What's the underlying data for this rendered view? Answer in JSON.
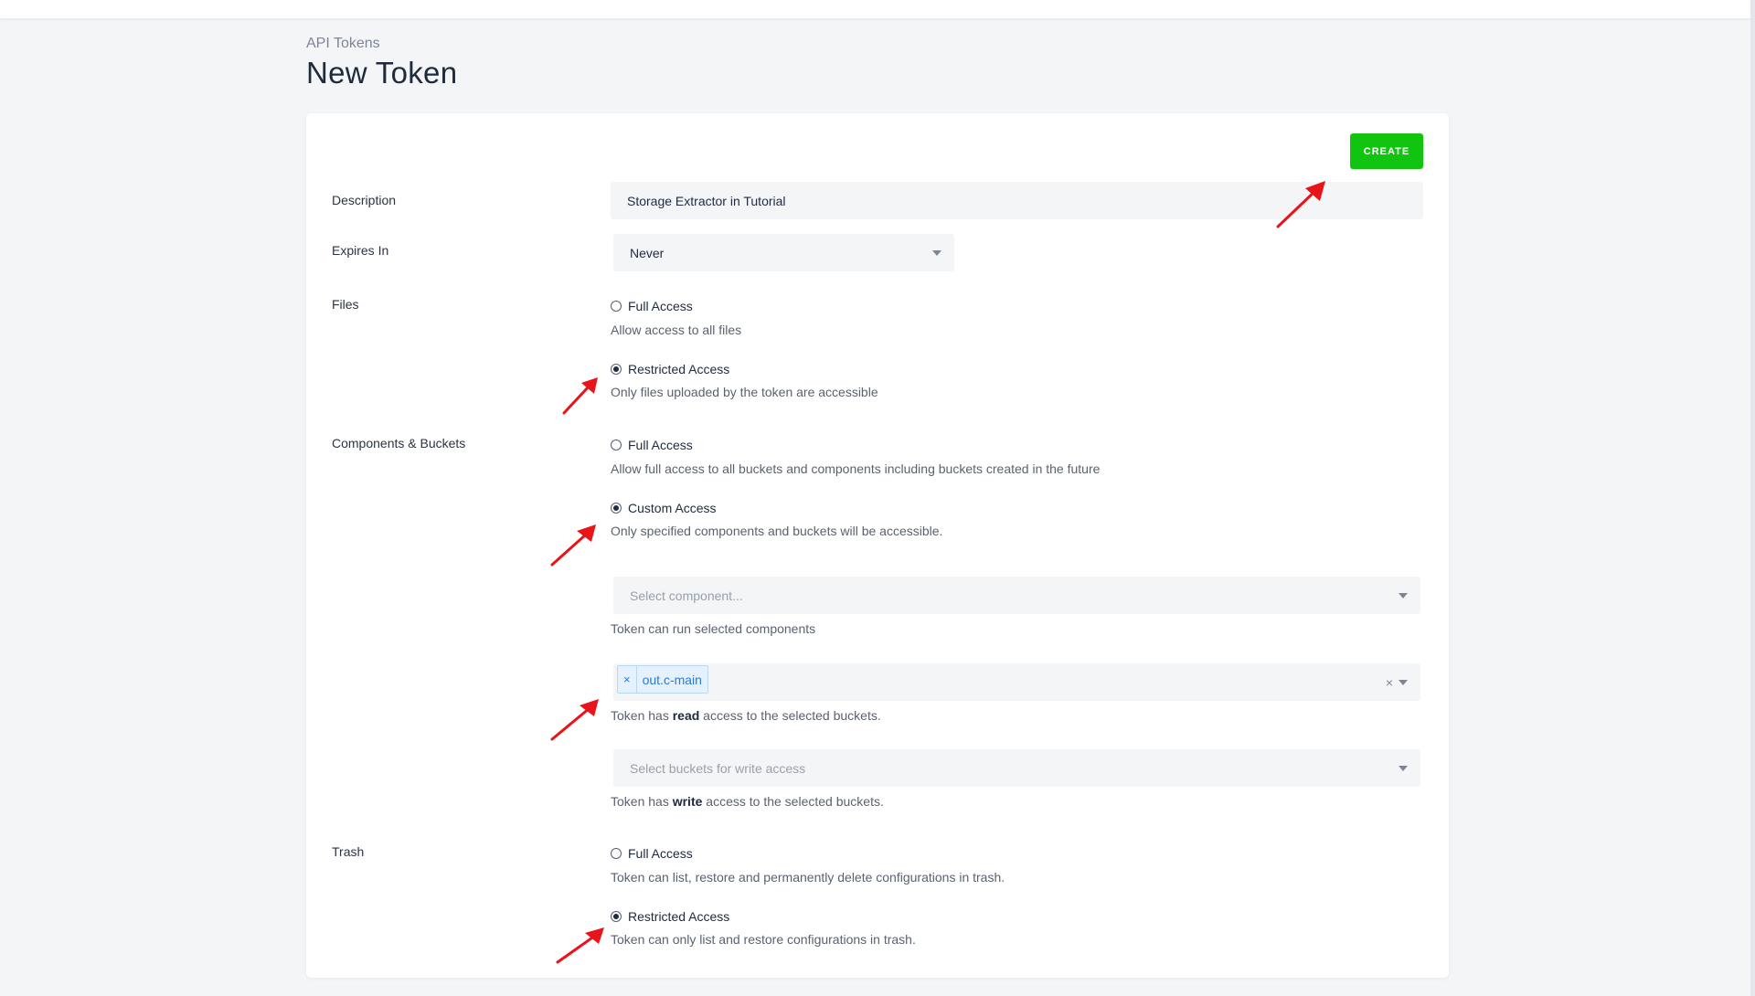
{
  "header": {
    "breadcrumb": "API Tokens",
    "title": "New Token"
  },
  "actions": {
    "create_label": "CREATE"
  },
  "form": {
    "description": {
      "label": "Description",
      "value": "Storage Extractor in Tutorial"
    },
    "expires": {
      "label": "Expires In",
      "value": "Never"
    },
    "files": {
      "label": "Files",
      "options": [
        {
          "label": "Full Access",
          "help": "Allow access to all files",
          "checked": false
        },
        {
          "label": "Restricted Access",
          "help": "Only files uploaded by the token are accessible",
          "checked": true
        }
      ]
    },
    "components": {
      "label": "Components & Buckets",
      "options": [
        {
          "label": "Full Access",
          "help": "Allow full access to all buckets and components including buckets created in the future",
          "checked": false
        },
        {
          "label": "Custom Access",
          "help": "Only specified components and buckets will be accessible.",
          "checked": true
        }
      ],
      "component_select": {
        "placeholder": "Select component...",
        "help": "Token can run selected components"
      },
      "read_buckets": {
        "tag": "out.c-main",
        "tag_remove": "×",
        "clear": "×",
        "help_prefix": "Token has ",
        "help_strong": "read",
        "help_suffix": " access to the selected buckets."
      },
      "write_buckets": {
        "placeholder": "Select buckets for write access",
        "help_prefix": "Token has ",
        "help_strong": "write",
        "help_suffix": " access to the selected buckets."
      }
    },
    "trash": {
      "label": "Trash",
      "options": [
        {
          "label": "Full Access",
          "help": "Token can list, restore and permanently delete configurations in trash.",
          "checked": false
        },
        {
          "label": "Restricted Access",
          "help": "Token can only list and restore configurations in trash.",
          "checked": true
        }
      ]
    }
  },
  "colors": {
    "accent_green": "#11c40f",
    "annotation_arrow": "#e8141a",
    "tag_blue": "#2b7bd6"
  }
}
